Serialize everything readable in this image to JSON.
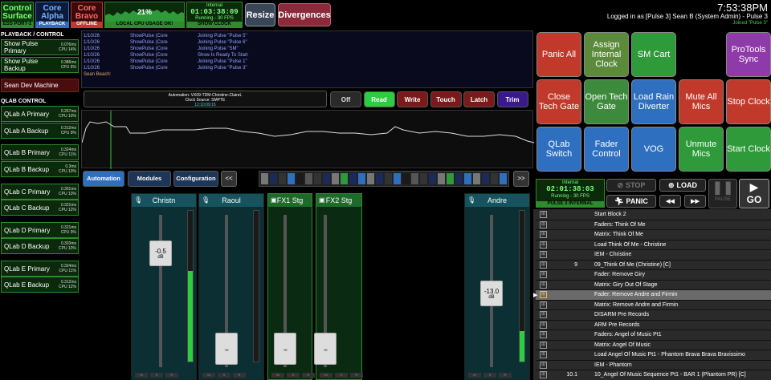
{
  "status": {
    "control_surface": {
      "title": "Control\nSurface",
      "sub": "ESS PORT-1"
    },
    "core_alpha": {
      "title": "Core\nAlpha",
      "sub": "PLAYBACK"
    },
    "core_bravo": {
      "title": "Core\nBravo",
      "sub": "OFFLINE"
    },
    "cpu": {
      "pct": "21%",
      "label": "LOCAL CPU USAGE OK!",
      "level": 0.21
    },
    "clock": {
      "title": "Internal",
      "time": "01:03:38:09",
      "rate": "Running - 30 FPS",
      "label": "SHOW CLOCK"
    }
  },
  "top_buttons": {
    "resize": "Resize",
    "divergences": "Divergences"
  },
  "header": {
    "time": "7:53:38PM",
    "user": "Logged in as [Pulse 3] Sean B (System Admin) - Pulse 3",
    "joined": "Joined \"Pulse 3\""
  },
  "sidebar": {
    "playback_header": "PLAYBACK / CONTROL",
    "pulse_items": [
      {
        "label": "Show Pulse Primary",
        "m1": "0.076ms",
        "m2": "CPU 14%"
      },
      {
        "label": "Show Pulse Backup",
        "m1": "0.386ms",
        "m2": "CPU 6%"
      }
    ],
    "dev_machine": "Sean Dev Machine",
    "qlab_header": "QLAB CONTROL",
    "qlab_items": [
      {
        "label": "QLab A Primary",
        "m1": "0.267ms",
        "m2": "CPU 10%"
      },
      {
        "label": "QLab A Backup",
        "m1": "0.312ms",
        "m2": "CPU 9%"
      },
      {
        "label": "QLab B Primary",
        "m1": "0.324ms",
        "m2": "CPU 11%"
      },
      {
        "label": "QLab B Backup",
        "m1": "0.3ms",
        "m2": "CPU 10%"
      },
      {
        "label": "QLab C Primary",
        "m1": "0.301ms",
        "m2": "CPU 13%"
      },
      {
        "label": "QLab C Backup",
        "m1": "0.321ms",
        "m2": "CPU 12%"
      },
      {
        "label": "QLab D Primary",
        "m1": "0.321ms",
        "m2": "CPU 9%"
      },
      {
        "label": "QLab D Backup",
        "m1": "0.303ms",
        "m2": "CPU 10%"
      },
      {
        "label": "QLab E Primary",
        "m1": "0.324ms",
        "m2": "CPU 11%"
      },
      {
        "label": "QLab E Backup",
        "m1": "0.312ms",
        "m2": "CPU 12%"
      }
    ]
  },
  "log": {
    "rows": [
      {
        "d": "1/10/26",
        "s": "ShowPulse (Core",
        "m": "Joining Pulse \"Pulse 5\""
      },
      {
        "d": "1/10/26",
        "s": "ShowPulse (Core",
        "m": "Joining Pulse \"Pulse 6\""
      },
      {
        "d": "1/10/26",
        "s": "ShowPulse (Core",
        "m": "Joining Pulse \"SM\""
      },
      {
        "d": "1/10/26",
        "s": "ShowPulse (Core",
        "m": "Show Is Ready To Start"
      },
      {
        "d": "1/10/26",
        "s": "ShowPulse (Core",
        "m": "Joining Pulse \"Pulse 1\""
      },
      {
        "d": "1/10/26",
        "s": "ShowPulse (Core",
        "m": "Joining Pulse \"Pulse 3\""
      }
    ],
    "input_label": "Sean Beach:"
  },
  "automation": {
    "info1": "Automation: VX09-TDM-Christine-ClaireL",
    "info2": "Clock Source: SMPTE",
    "info3": "12:10:09:15",
    "modes": [
      "Off",
      "Read",
      "Write",
      "Touch",
      "Latch",
      "Trim"
    ],
    "tabs": [
      "Automation",
      "Modules",
      "Configuration"
    ],
    "prev": "<<",
    "next": ">>"
  },
  "grid_buttons": [
    {
      "label": "Panic All",
      "color": "#c0392b"
    },
    {
      "label": "Assign Internal Clock",
      "color": "#5a8a3a"
    },
    {
      "label": "SM Cart",
      "color": "#2e9a3a"
    },
    {
      "label": "",
      "color": "#000000"
    },
    {
      "label": "ProTools Sync",
      "color": "#8e3aa8"
    },
    {
      "label": "Close Tech Gate",
      "color": "#c0392b"
    },
    {
      "label": "Open Tech Gate",
      "color": "#3d8a3d"
    },
    {
      "label": "Load Rain Diverter",
      "color": "#2f6fc0"
    },
    {
      "label": "Mute All Mics",
      "color": "#c0392b"
    },
    {
      "label": "Stop Clock",
      "color": "#c0392b"
    },
    {
      "label": "QLab Switch",
      "color": "#2f6fc0"
    },
    {
      "label": "Fader Control",
      "color": "#2f6fc0"
    },
    {
      "label": "VOG",
      "color": "#2f6fc0"
    },
    {
      "label": "Unmute Mics",
      "color": "#2e9a3a"
    },
    {
      "label": "Start Clock",
      "color": "#2e9a3a"
    }
  ],
  "pulse_clock": {
    "title": "Internal",
    "time": "02:01:38:03",
    "rate": "Running - 30 FPS",
    "label": "PULSE 3 INTERNAL"
  },
  "transport": {
    "stop": "STOP",
    "panic": "PANIC",
    "load": "LOAD",
    "pause": "PAUSE",
    "go": "GO",
    "prev": "◀◀",
    "next": "▶▶"
  },
  "channels": [
    {
      "name": "Christn",
      "value": "-0.5",
      "unit": "dB",
      "meter": 0.6
    },
    {
      "name": "Raoul",
      "value": "-∞",
      "unit": "",
      "meter": 0
    },
    {
      "name": "FX1 Stg",
      "value": "-∞",
      "unit": "",
      "meter": 0
    },
    {
      "name": "FX2 Stg",
      "value": "-∞",
      "unit": "",
      "meter": 0
    },
    {
      "name": "Andre",
      "value": "-13.0",
      "unit": "dB",
      "meter": 0.2
    }
  ],
  "strip_buttons": [
    "M",
    "S",
    "R"
  ],
  "cue_list": [
    {
      "num": "",
      "name": "Start Block 2"
    },
    {
      "num": "",
      "name": "Faders: Think Of Me"
    },
    {
      "num": "",
      "name": "Matrix: Think Of Me"
    },
    {
      "num": "",
      "name": "Load Think Of Me - Christine"
    },
    {
      "num": "",
      "name": "IEM - Christine"
    },
    {
      "num": "9",
      "name": "09_Think Of Me (Christine) [C]"
    },
    {
      "num": "",
      "name": "Fader: Remove Giry"
    },
    {
      "num": "",
      "name": "Matrix: Giry Out Of Stage"
    },
    {
      "num": "",
      "name": "Fader: Remove Andre and Firmin",
      "selected": true
    },
    {
      "num": "",
      "name": "Matrix: Remove Andre and Firmin"
    },
    {
      "num": "",
      "name": "DISARM Pre Records"
    },
    {
      "num": "",
      "name": "ARM Pre Records"
    },
    {
      "num": "",
      "name": "Faders: Angel of Music Pt1"
    },
    {
      "num": "",
      "name": "Matrix: Angel Of Music"
    },
    {
      "num": "",
      "name": "Load Angel Of Music Pt1 - Phantom Brava Brava Bravissimo"
    },
    {
      "num": "",
      "name": "IEM - Phantom"
    },
    {
      "num": "10.1",
      "name": "10_Angel Of Music Sequence Pt1 - BAR 1 (Phantom PR) [C]"
    }
  ]
}
